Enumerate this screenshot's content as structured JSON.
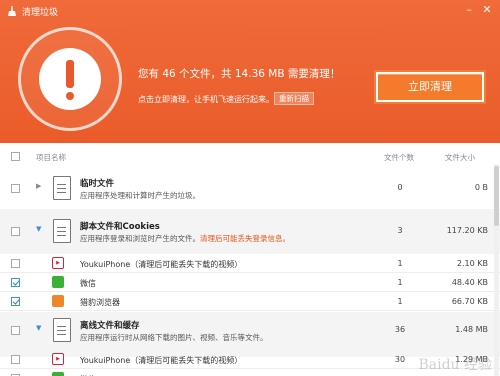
{
  "window": {
    "title": "清理垃圾",
    "minimize_icon": "minimize-icon",
    "close_icon": "close-icon"
  },
  "summary": {
    "message": "您有 46 个文件，共 14.36 MB 需要清理！",
    "hint": "点击立即清理，让手机飞速运行起来。",
    "rescan_label": "重新扫描",
    "clean_label": "立即清理"
  },
  "columns": {
    "name": "项目名称",
    "count": "文件个数",
    "size": "文件大小"
  },
  "groups": [
    {
      "title": "临时文件",
      "desc": "应用程序处理和计算时产生的垃圾。",
      "warn": "",
      "count": "0",
      "size": "0 B",
      "checked": false,
      "expanded": false
    },
    {
      "title": "脚本文件和Cookies",
      "desc": "应用程序登录和浏览时产生的文件。",
      "warn": "清理后可能丢失登录信息。",
      "count": "3",
      "size": "117.20 KB",
      "checked": false,
      "expanded": true,
      "children": [
        {
          "name": "YoukuiPhone（清理后可能丢失下载的视频）",
          "count": "1",
          "size": "2.10 KB",
          "checked": false,
          "icon": "youku-icon"
        },
        {
          "name": "微信",
          "count": "1",
          "size": "48.40 KB",
          "checked": true,
          "icon": "wechat-icon"
        },
        {
          "name": "猎豹浏览器",
          "count": "1",
          "size": "66.70 KB",
          "checked": true,
          "icon": "liebao-browser-icon"
        }
      ]
    },
    {
      "title": "离线文件和缓存",
      "desc": "应用程序运行时从网络下载的图片、视频、音乐等文件。",
      "warn": "",
      "count": "36",
      "size": "1.48 MB",
      "checked": false,
      "expanded": true,
      "children": [
        {
          "name": "YoukuiPhone（清理后可能丢失下载的视频）",
          "count": "30",
          "size": "1.29 MB",
          "checked": false,
          "icon": "youku-icon"
        },
        {
          "name": "微信",
          "count": "",
          "size": "",
          "checked": false,
          "icon": "wechat-icon"
        }
      ]
    }
  ],
  "watermark": "Baidu 经验",
  "colors": {
    "header_orange": "#ea5c2a",
    "button_orange": "#f37b2b",
    "warn_text": "#e8541c",
    "check_blue": "#2b7cc4"
  }
}
